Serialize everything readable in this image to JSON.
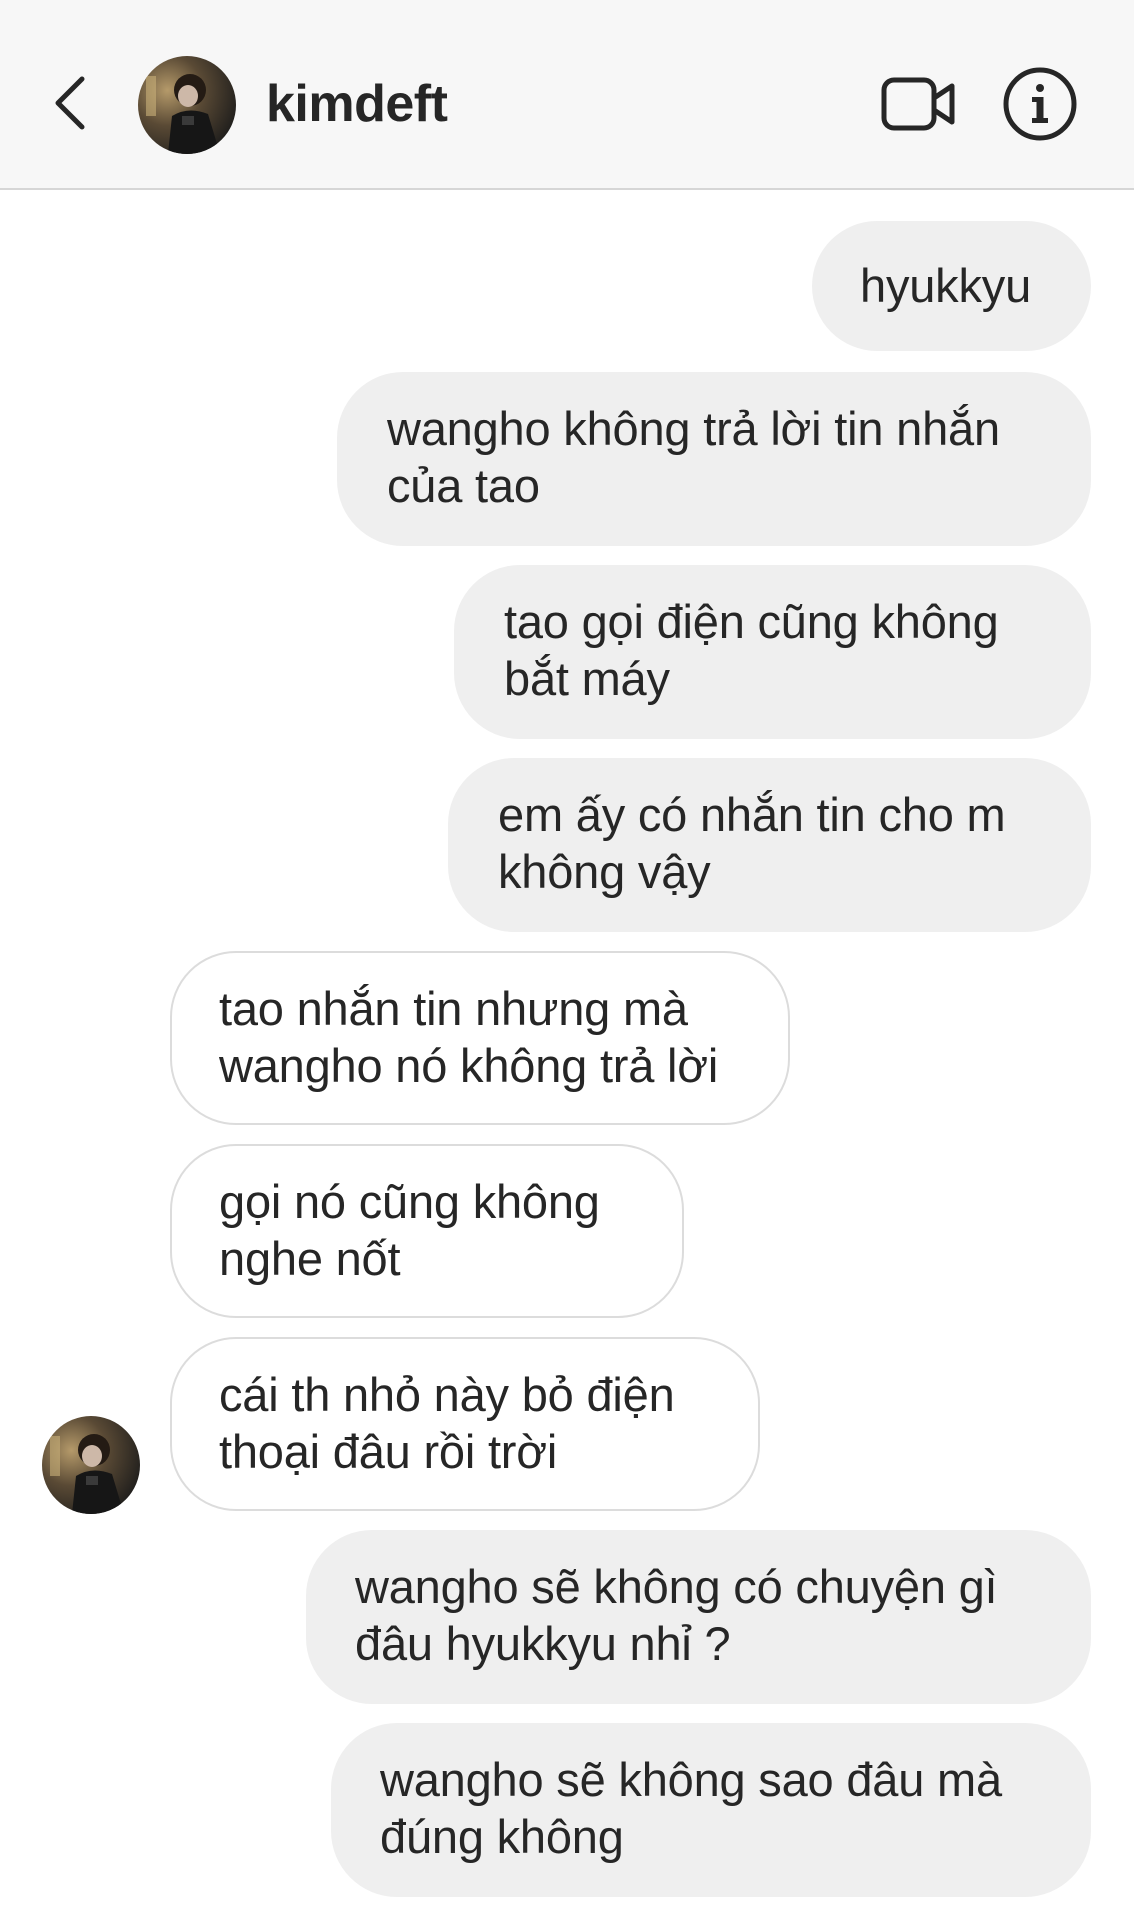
{
  "header": {
    "username": "kimdeft",
    "back_icon": "chevron-left-icon",
    "video_icon": "video-camera-icon",
    "info_icon": "info-circle-icon"
  },
  "colors": {
    "outgoing_bubble": "#efefef",
    "incoming_bubble_border": "#dcdcdc",
    "header_bg": "#f7f7f7",
    "text": "#262626"
  },
  "messages": [
    {
      "direction": "outgoing",
      "text": "hyukkyu"
    },
    {
      "direction": "outgoing",
      "text": "wangho không trả lời tin nhắn\ncủa tao"
    },
    {
      "direction": "outgoing",
      "text": "tao gọi điện cũng không\nbắt máy"
    },
    {
      "direction": "outgoing",
      "text": "em ấy có nhắn tin cho m\nkhông vậy"
    },
    {
      "direction": "incoming",
      "text": "tao nhắn tin nhưng mà\nwangho nó không trả lời"
    },
    {
      "direction": "incoming",
      "text": "gọi nó cũng không\nnghe nốt"
    },
    {
      "direction": "incoming",
      "text": "cái th nhỏ này bỏ điện\nthoại đâu rồi trời"
    },
    {
      "direction": "outgoing",
      "text": "wangho sẽ không có chuyện gì\nđâu hyukkyu nhỉ ?"
    },
    {
      "direction": "outgoing",
      "text": "wangho sẽ không sao đâu mà\nđúng không"
    }
  ]
}
